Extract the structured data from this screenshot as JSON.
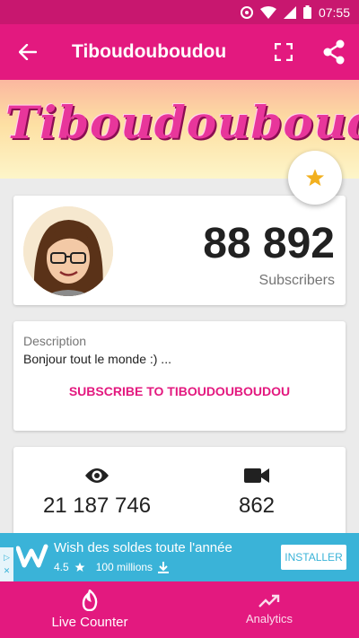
{
  "status_bar": {
    "time": "07:55"
  },
  "app_bar": {
    "title": "Tiboudouboudou"
  },
  "banner": {
    "text": "Tiboudouboudou"
  },
  "profile": {
    "subscriber_count": "88 892",
    "subscriber_label": "Subscribers"
  },
  "description": {
    "label": "Description",
    "text": "Bonjour tout le monde :) ...",
    "subscribe_label": "SUBSCRIBE TO TIBOUDOUBOUDOU"
  },
  "stats": {
    "views": "21 187 746",
    "videos": "862"
  },
  "ad": {
    "title": "Wish des soldes toute l'année",
    "rating": "4.5",
    "downloads": "100 millions",
    "install_label": "INSTALLER"
  },
  "bottom_nav": {
    "items": [
      {
        "label": "Live Counter",
        "icon": "flame-icon",
        "active": true
      },
      {
        "label": "Analytics",
        "icon": "trending-up-icon",
        "active": false
      }
    ]
  },
  "colors": {
    "primary": "#e3197f",
    "status_bar": "#c8176f",
    "ad_blue": "#3ab3d8",
    "star": "#f2b01e"
  }
}
